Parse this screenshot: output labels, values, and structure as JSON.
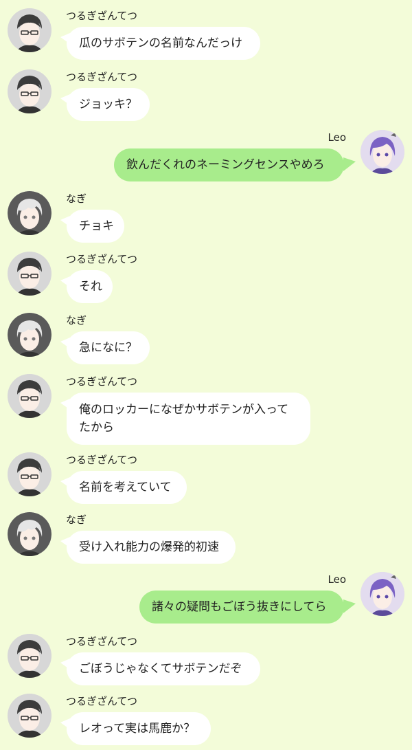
{
  "speakers": {
    "tsuru": "つるぎざんてつ",
    "nagi": "なぎ",
    "leo": "Leo"
  },
  "messages": [
    {
      "speaker": "つるぎざんてつ",
      "side": "left",
      "text": "瓜のサボテンの名前なんだっけ"
    },
    {
      "speaker": "つるぎざんてつ",
      "side": "left",
      "text": "ジョッキ？"
    },
    {
      "speaker": "Leo",
      "side": "right",
      "text": "飲んだくれのネーミングセンスやめろ"
    },
    {
      "speaker": "なぎ",
      "side": "left",
      "text": "チョキ"
    },
    {
      "speaker": "つるぎざんてつ",
      "side": "left",
      "text": "それ"
    },
    {
      "speaker": "なぎ",
      "side": "left",
      "text": "急になに？"
    },
    {
      "speaker": "つるぎざんてつ",
      "side": "left",
      "lines": [
        "俺のロッカーになぜかサボテンが入って",
        "たから"
      ]
    },
    {
      "speaker": "つるぎざんてつ",
      "side": "left",
      "text": "名前を考えていて"
    },
    {
      "speaker": "なぎ",
      "side": "left",
      "text": "受け入れ能力の爆発的初速"
    },
    {
      "speaker": "Leo",
      "side": "right",
      "text": "諸々の疑問もごぼう抜きにしてら"
    },
    {
      "speaker": "つるぎざんてつ",
      "side": "left",
      "text": "ごぼうじゃなくてサボテンだぞ"
    },
    {
      "speaker": "つるぎざんてつ",
      "side": "left",
      "text": "レオって実は馬鹿か？"
    }
  ],
  "colors": {
    "background": "#f3fcd9",
    "bubble_left": "#ffffff",
    "bubble_right": "#a8ec8c"
  }
}
